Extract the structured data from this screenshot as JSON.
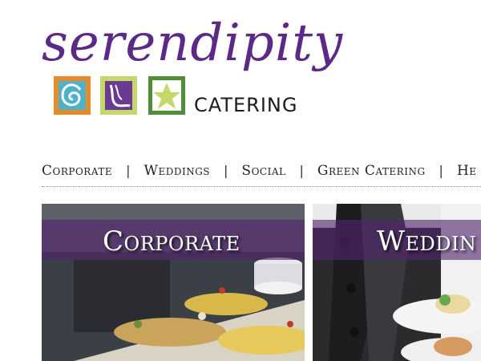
{
  "logo": {
    "script_text": "serendipity",
    "tagline": "CATERING",
    "tiles": [
      {
        "icon": "swirl-icon",
        "color": "#4fb1c7",
        "frame": "#e8892a"
      },
      {
        "icon": "wave-icon",
        "color": "#6b3a92",
        "frame": "#c7d86a"
      },
      {
        "icon": "star-icon",
        "color": "#c7d86a",
        "frame": "#4f8f35"
      }
    ]
  },
  "nav": {
    "items": [
      "Corporate",
      "Weddings",
      "Social",
      "Green Catering",
      "He"
    ],
    "separator": "|"
  },
  "tiles": [
    {
      "label": "Corporate"
    },
    {
      "label": "Weddin"
    }
  ],
  "colors": {
    "brand_purple": "#5b2a86",
    "banner_purple": "#50236e"
  }
}
